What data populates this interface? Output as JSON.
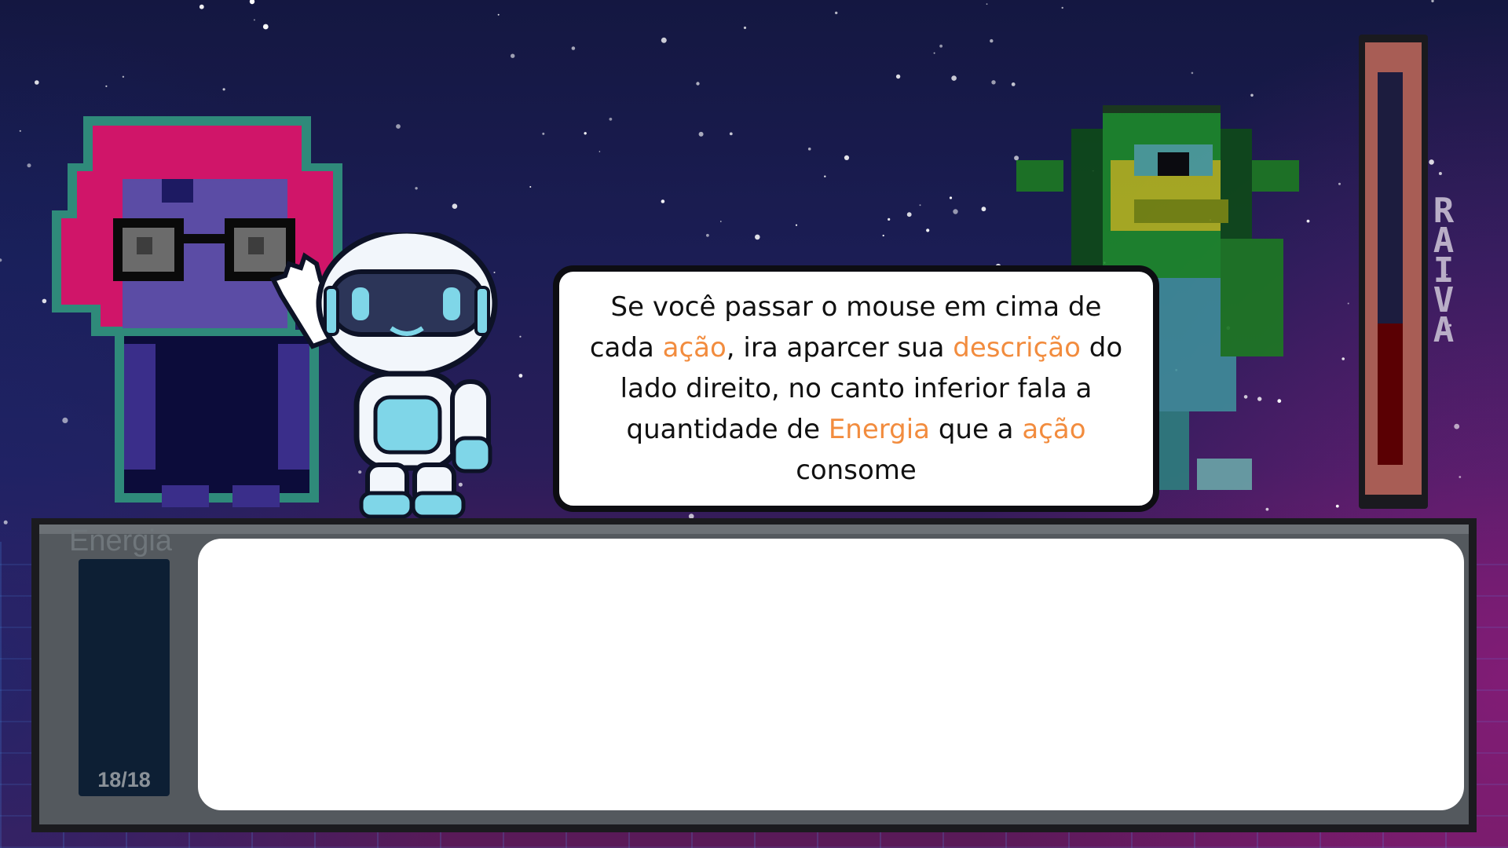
{
  "dialog": {
    "part1": "Se você passar o mouse em cima de cada ",
    "hl1": "ação",
    "part2": ", ira aparcer sua ",
    "hl2": "descrição",
    "part3": " do lado direito, no canto inferior fala a quantidade de ",
    "hl3": "Energia",
    "part4": " que a ",
    "hl4": "ação",
    "part5": " consome"
  },
  "rage": {
    "label": "RAIVA",
    "level": 0.36,
    "fill_color": "#5a0003"
  },
  "energy": {
    "label": "Energia",
    "count": "18/18",
    "current": 18,
    "max": 18
  },
  "characters": {
    "player": "pink-haired-glasses-character",
    "guide": "robot-astronaut-guide",
    "enemy": "green-goblin-enemy"
  },
  "colors": {
    "highlight": "#f28c3e",
    "rage_frame": "#a85d55"
  }
}
